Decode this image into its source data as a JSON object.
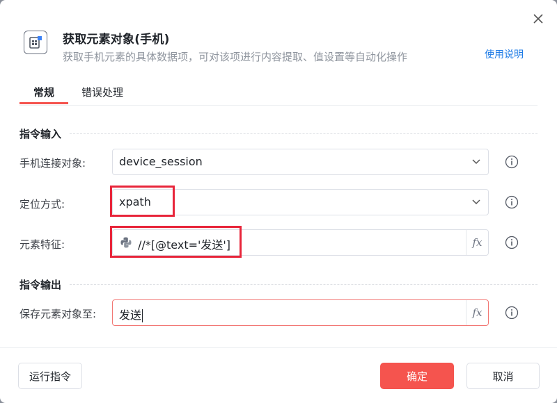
{
  "header": {
    "title": "获取元素对象(手机)",
    "subtitle": "获取手机元素的具体数据项，可对该项进行内容提取、值设置等自动化操作",
    "help_link": "使用说明"
  },
  "tabs": [
    {
      "label": "常规",
      "active": true
    },
    {
      "label": "错误处理",
      "active": false
    }
  ],
  "sections": {
    "input_title": "指令输入",
    "output_title": "指令输出"
  },
  "fields": {
    "device": {
      "label": "手机连接对象:",
      "value": "device_session"
    },
    "locate": {
      "label": "定位方式:",
      "value": "xpath"
    },
    "feature": {
      "label": "元素特征:",
      "value": "//*[@text='发送']"
    },
    "save_to": {
      "label": "保存元素对象至:",
      "value": "发送"
    }
  },
  "fx_label": "fx",
  "footer": {
    "run_label": "运行指令",
    "ok_label": "确定",
    "cancel_label": "取消"
  },
  "colors": {
    "accent": "#f5544e",
    "link": "#1e7be6",
    "highlight": "#e8253a",
    "error_border": "#f27874"
  },
  "icons": {
    "close": "close-icon",
    "header": "element-object-icon",
    "chevron": "chevron-down-icon",
    "info": "info-icon",
    "python": "python-icon"
  }
}
